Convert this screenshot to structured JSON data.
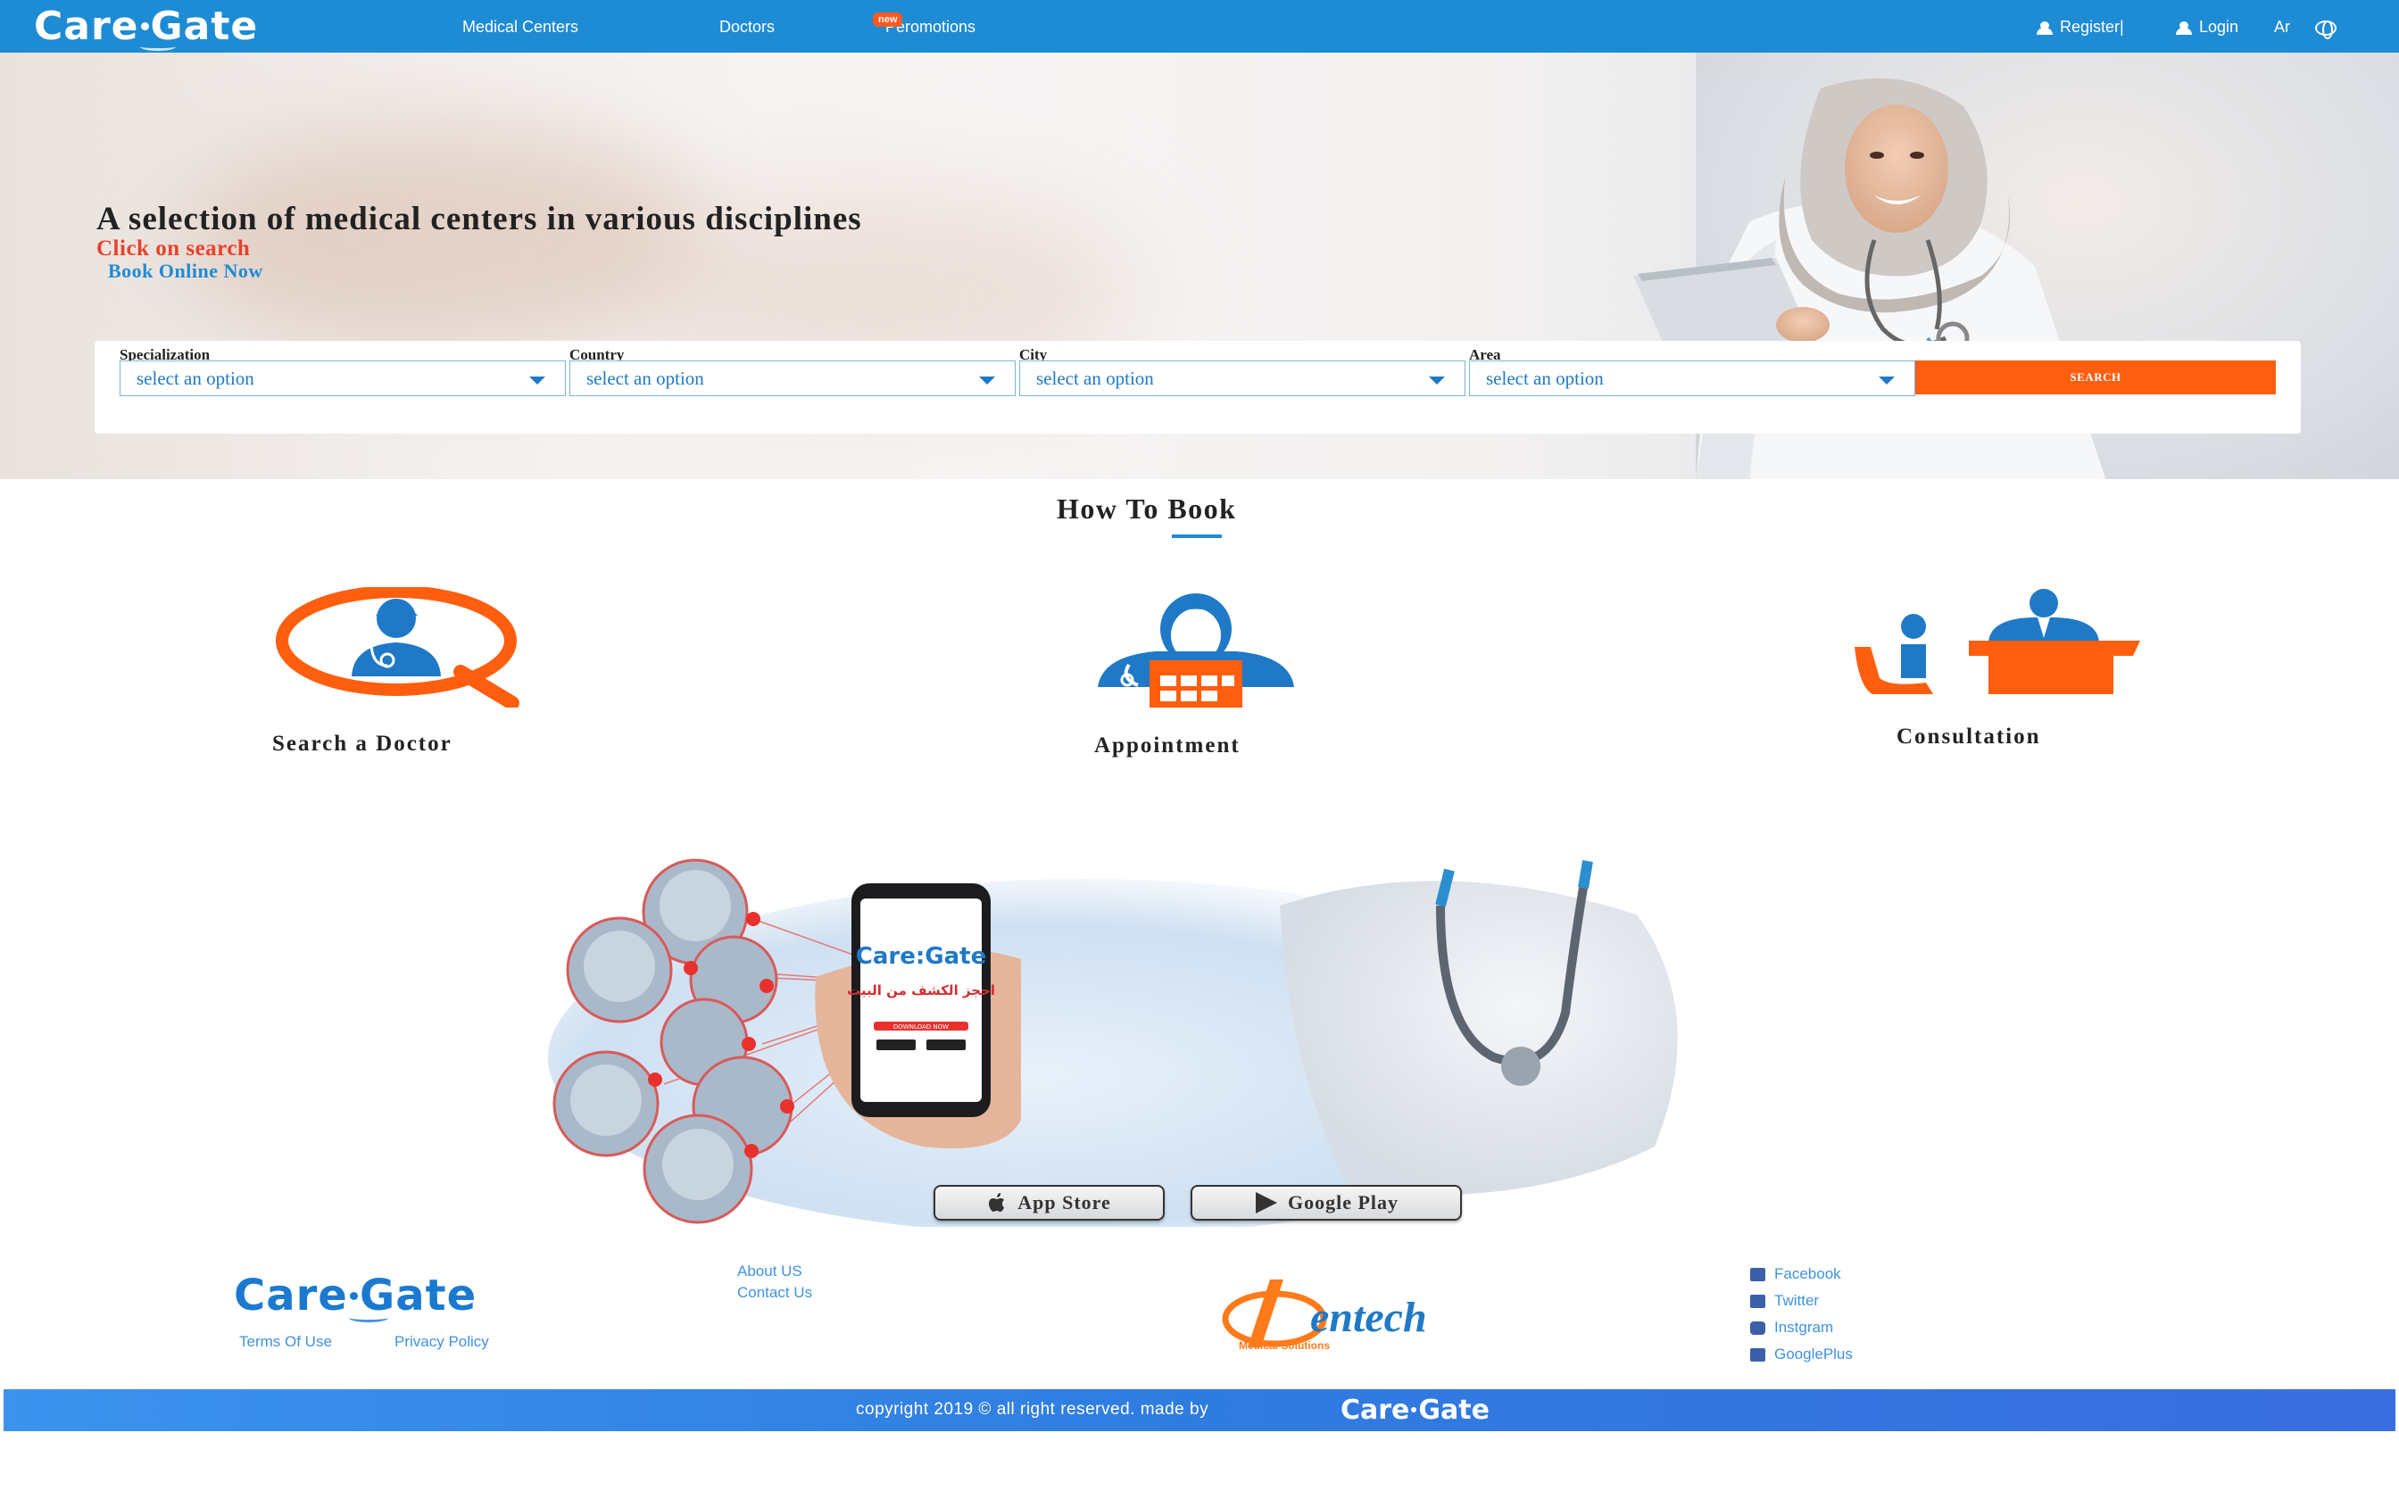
{
  "brand": {
    "logo_text": "Care:Gate",
    "logo_part1": "Care",
    "logo_part2": "ate"
  },
  "nav": {
    "links": [
      "Medical Centers",
      "Doctors",
      "Peromotions"
    ],
    "new_badge": "new",
    "register": "Register|",
    "login": "Login",
    "lang": "Ar"
  },
  "hero": {
    "title": "A selection of medical centers in various disciplines",
    "click": "Click on search",
    "book": "Book Online Now"
  },
  "search": {
    "fields": [
      {
        "label": "Specialization",
        "value": "select an option"
      },
      {
        "label": "Country",
        "value": "select an option"
      },
      {
        "label": "City",
        "value": "select an option"
      },
      {
        "label": "Area",
        "value": "select an option"
      }
    ],
    "button": "SEARCH"
  },
  "how_to_book": {
    "title": "How To Book",
    "steps": [
      "Search a Doctor",
      "Appointment",
      "Consultation"
    ]
  },
  "promo": {
    "arabic_text": "احجز الكشف من البيت",
    "download_text": "DOWNLOAD NOW",
    "app_store": "App Store",
    "google_play": "Google Play"
  },
  "footer": {
    "terms": "Terms Of Use",
    "privacy": "Privacy Policy",
    "about": "About US",
    "contact": "Contact Us",
    "dentech": "entech",
    "dentech_sub": "Medical Solutions",
    "social": [
      "Facebook",
      "Twitter",
      "Instgram",
      "GooglePlus"
    ],
    "copyright": "copyright 2019 © all right reserved. made by"
  },
  "colors": {
    "nav_blue": "#1e8bd5",
    "accent_orange": "#ff5e0e",
    "brand_blue": "#1f8ad6",
    "click_red": "#e8412a"
  }
}
